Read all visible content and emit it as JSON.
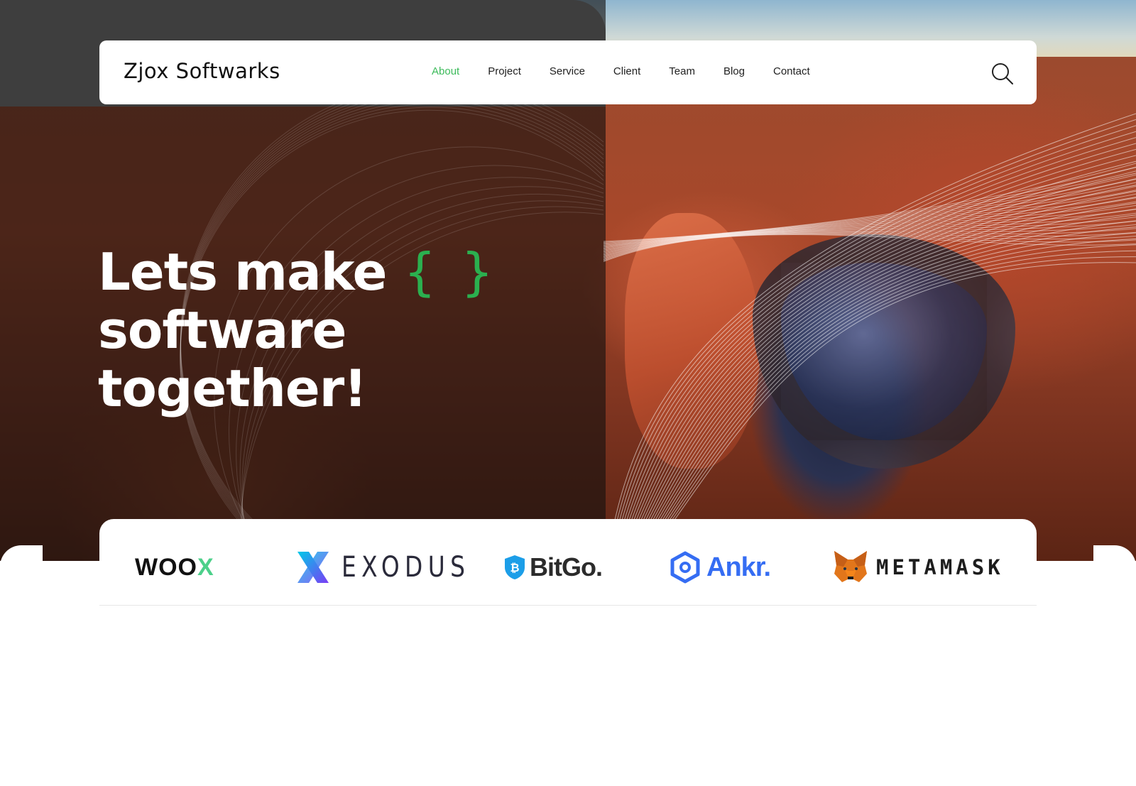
{
  "brand": {
    "name": "Zjox Softwarks"
  },
  "nav": {
    "items": [
      {
        "label": "About",
        "active": true
      },
      {
        "label": "Project",
        "active": false
      },
      {
        "label": "Service",
        "active": false
      },
      {
        "label": "Client",
        "active": false
      },
      {
        "label": "Team",
        "active": false
      },
      {
        "label": "Blog",
        "active": false
      },
      {
        "label": "Contact",
        "active": false
      }
    ],
    "search_icon": "search-icon"
  },
  "hero": {
    "line1": "Lets make",
    "braces": "{ }",
    "line2": "software together!"
  },
  "logos": {
    "woox": {
      "text": "WOO",
      "accent": "X"
    },
    "exodus": {
      "text": "EXODUS"
    },
    "bitgo": {
      "text": "BitGo."
    },
    "ankr": {
      "text": "Ankr."
    },
    "metamask": {
      "text": "METAMASK"
    }
  },
  "colors": {
    "accent_green": "#3dbb5b",
    "brace_green": "#2bb04f",
    "woox_accent": "#4cd08a",
    "bitgo_blue": "#1c9ee8",
    "ankr_blue": "#356df3",
    "exodus_purple": "#6a4cf5"
  }
}
